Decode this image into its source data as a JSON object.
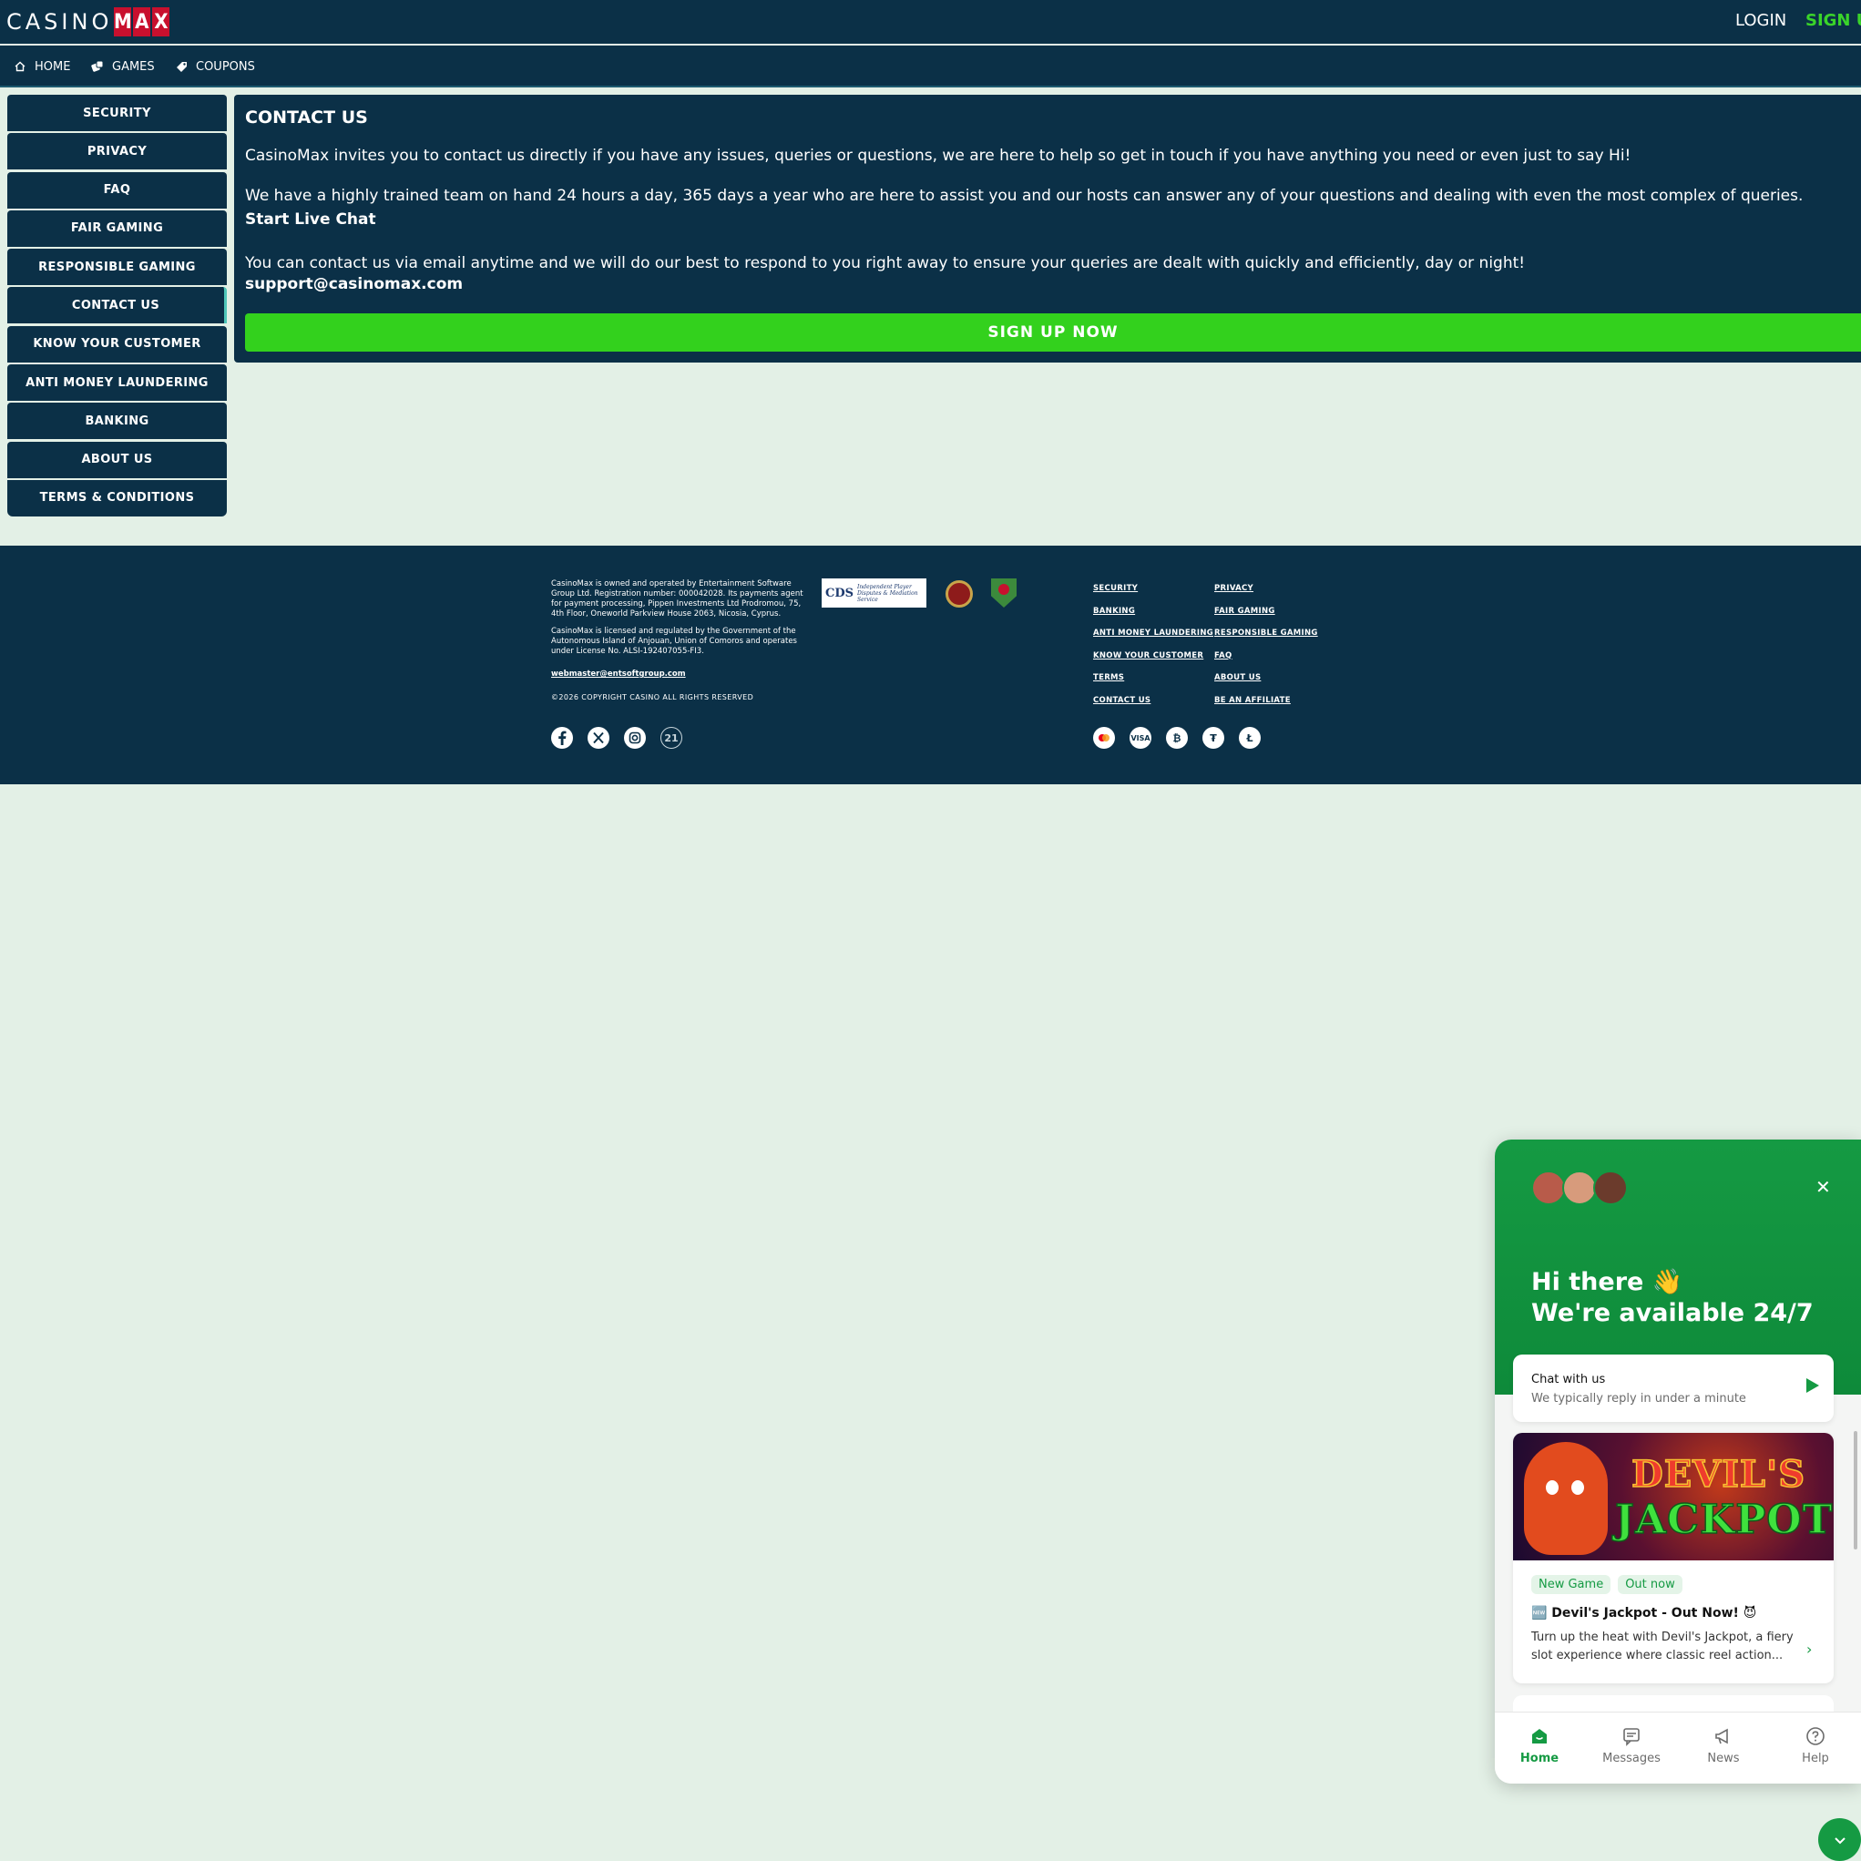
{
  "header": {
    "logo_casino": "CASINO",
    "logo_max": [
      "M",
      "A",
      "X"
    ],
    "login": "LOGIN",
    "signup": "SIGN UP"
  },
  "subnav": [
    {
      "label": "HOME",
      "icon": "home-icon"
    },
    {
      "label": "GAMES",
      "icon": "dice-icon"
    },
    {
      "label": "COUPONS",
      "icon": "ticket-icon"
    }
  ],
  "sidebar": {
    "items": [
      {
        "label": "SECURITY"
      },
      {
        "label": "PRIVACY"
      },
      {
        "label": "FAQ"
      },
      {
        "label": "FAIR GAMING"
      },
      {
        "label": "RESPONSIBLE GAMING"
      },
      {
        "label": "CONTACT US",
        "active": true
      },
      {
        "label": "KNOW YOUR CUSTOMER"
      },
      {
        "label": "ANTI MONEY LAUNDERING"
      },
      {
        "label": "BANKING"
      },
      {
        "label": "ABOUT US"
      },
      {
        "label": "TERMS & CONDITIONS"
      }
    ]
  },
  "main": {
    "title": "CONTACT US",
    "p1": "CasinoMax invites you to contact us directly if you have any issues, queries or questions, we are here to help so get in touch if you have anything you need or even just to say Hi!",
    "p2": "We have a highly trained team on hand 24 hours a day, 365 days a year who are here to assist you and our hosts can answer any of your questions and dealing with even the most complex of queries.",
    "live_chat": "Start Live Chat",
    "p3": "You can contact us via email anytime and we will do our best to respond to you right away to ensure your queries are dealt with quickly and efficiently, day or night!",
    "email": "support@casinomax.com",
    "signup_button": "SIGN UP NOW"
  },
  "footer": {
    "owner_text": "CasinoMax is owned and operated by Entertainment Software Group Ltd. Registration number: 000042028. Its payments agent for payment processing, Pippen Investments Ltd Prodromou, 75, 4th Floor, Oneworld Parkview House 2063, Nicosia, Cyprus.",
    "license_text": "CasinoMax is licensed and regulated by the Government of the Autonomous Island of Anjouan, Union of Comoros and operates under License No. ALSI-192407055-FI3.",
    "webmaster": "webmaster@entsoftgroup.com",
    "copyright": "©2026 COPYRIGHT CASINO ALL RIGHTS RESERVED",
    "cds_logo": "CDS",
    "cds_text": "Independent Player Disputes & Mediation Service",
    "social_icons": [
      "facebook-icon",
      "x-icon",
      "instagram-icon",
      "age-21-icon"
    ],
    "age_label": "21",
    "links": [
      "SECURITY",
      "PRIVACY",
      "BANKING",
      "FAIR GAMING",
      "ANTI MONEY LAUNDERING",
      "RESPONSIBLE GAMING",
      "KNOW YOUR CUSTOMER",
      "FAQ",
      "TERMS",
      "ABOUT US",
      "CONTACT US",
      "BE AN AFFILIATE"
    ],
    "payment_icons": [
      "mastercard-icon",
      "visa-icon",
      "bitcoin-icon",
      "tether-icon",
      "litecoin-icon"
    ],
    "visa_label": "VISA"
  },
  "chat_widget": {
    "greeting_line1": "Hi there 👋",
    "greeting_line2": "We're available 24/7",
    "chat_title": "Chat with us",
    "chat_subtitle": "We typically reply in under a minute",
    "news": {
      "banner_line1": "DEVIL'S",
      "banner_line2": "JACKPOT",
      "tags": [
        "New Game",
        "Out now"
      ],
      "title": "🆕 Devil's Jackpot - Out Now! 😈",
      "body": "Turn up the heat with Devil's Jackpot, a fiery slot experience where classic reel action..."
    },
    "tabs": [
      {
        "label": "Home",
        "icon": "home-icon",
        "active": true
      },
      {
        "label": "Messages",
        "icon": "messages-icon"
      },
      {
        "label": "News",
        "icon": "megaphone-icon"
      },
      {
        "label": "Help",
        "icon": "help-icon"
      }
    ]
  },
  "colors": {
    "navy": "#0b3047",
    "green_cta": "#33d11d",
    "widget_green": "#159a43",
    "background": "#e3f0e6",
    "logo_red": "#c8102e"
  }
}
